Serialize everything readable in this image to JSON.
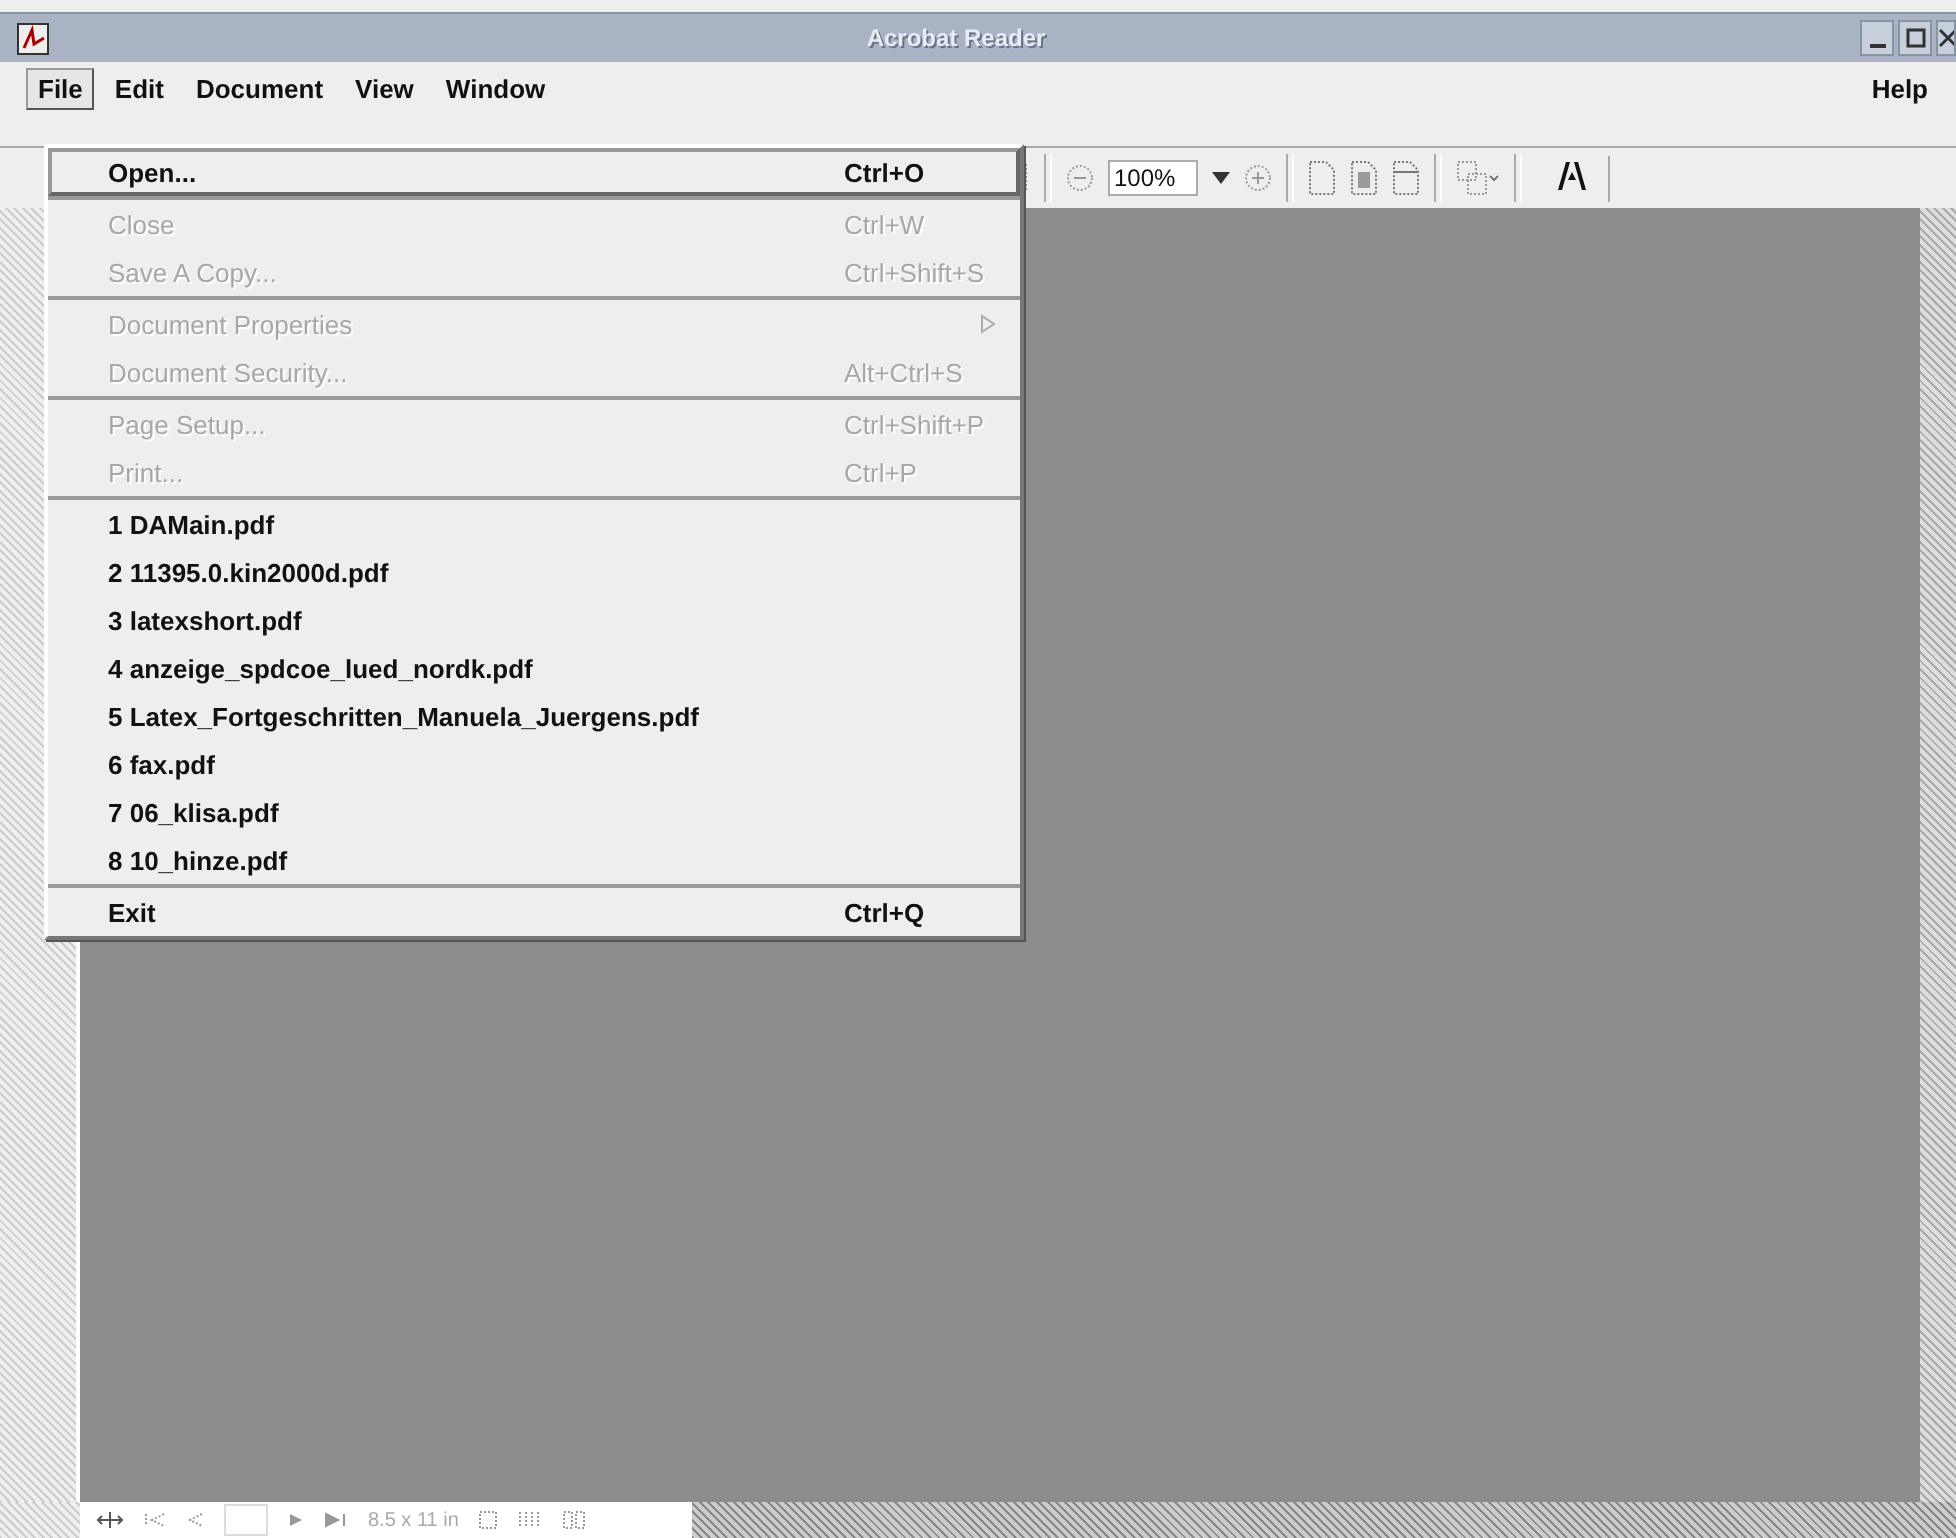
{
  "window": {
    "title": "Acrobat Reader"
  },
  "menubar": {
    "left": [
      {
        "label": "File",
        "selected": true
      },
      {
        "label": "Edit",
        "selected": false
      },
      {
        "label": "Document",
        "selected": false
      },
      {
        "label": "View",
        "selected": false
      },
      {
        "label": "Window",
        "selected": false
      }
    ],
    "right": [
      {
        "label": "Help",
        "selected": false
      }
    ]
  },
  "toolbar": {
    "zoom": "100%"
  },
  "menu": {
    "sections": [
      [
        {
          "label": "Open...",
          "shortcut": "Ctrl+O",
          "disabled": false,
          "selected": true
        }
      ],
      [
        {
          "label": "Close",
          "shortcut": "Ctrl+W",
          "disabled": true,
          "selected": false
        },
        {
          "label": "Save A Copy...",
          "shortcut": "Ctrl+Shift+S",
          "disabled": true,
          "selected": false
        }
      ],
      [
        {
          "label": "Document Properties",
          "submenu": true,
          "disabled": true,
          "selected": false
        },
        {
          "label": "Document Security...",
          "shortcut": "Alt+Ctrl+S",
          "disabled": true,
          "selected": false
        }
      ],
      [
        {
          "label": "Page Setup...",
          "shortcut": "Ctrl+Shift+P",
          "disabled": true,
          "selected": false
        },
        {
          "label": "Print...",
          "shortcut": "Ctrl+P",
          "disabled": true,
          "selected": false
        }
      ],
      [
        {
          "label": "1 DAMain.pdf",
          "disabled": false,
          "selected": false
        },
        {
          "label": "2 11395.0.kin2000d.pdf",
          "disabled": false,
          "selected": false
        },
        {
          "label": "3 latexshort.pdf",
          "disabled": false,
          "selected": false
        },
        {
          "label": "4 anzeige_spdcoe_lued_nordk.pdf",
          "disabled": false,
          "selected": false
        },
        {
          "label": "5 Latex_Fortgeschritten_Manuela_Juergens.pdf",
          "disabled": false,
          "selected": false
        },
        {
          "label": "6 fax.pdf",
          "disabled": false,
          "selected": false
        },
        {
          "label": "7 06_klisa.pdf",
          "disabled": false,
          "selected": false
        },
        {
          "label": "8 10_hinze.pdf",
          "disabled": false,
          "selected": false
        }
      ],
      [
        {
          "label": "Exit",
          "shortcut": "Ctrl+Q",
          "disabled": false,
          "selected": false
        }
      ]
    ]
  },
  "status_bar": {
    "page_size": "8.5 x 11 in"
  }
}
